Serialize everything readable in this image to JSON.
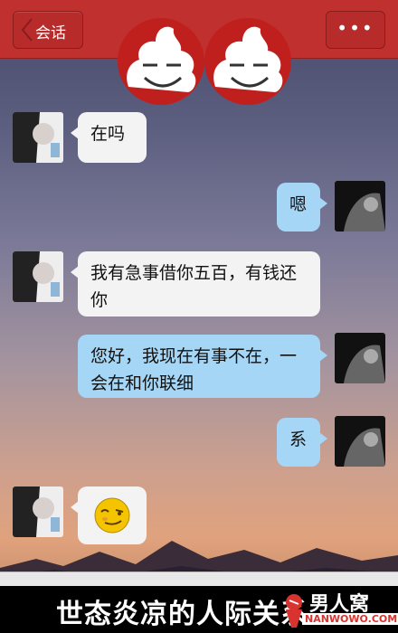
{
  "topbar": {
    "back_label": "会话",
    "title": "",
    "more_label": "•••"
  },
  "messages": [
    {
      "side": "in",
      "text": "在吗"
    },
    {
      "side": "out",
      "text": "嗯"
    },
    {
      "side": "in",
      "text": "我有急事借你五百，有钱还你"
    },
    {
      "side": "out",
      "text": "您好，我现在有事不在，一会在和你联细"
    },
    {
      "side": "out",
      "text": "系"
    },
    {
      "side": "in",
      "text": "",
      "emoji": "smirk-emoji"
    }
  ],
  "caption": {
    "text": "世态炎凉的人际关系"
  },
  "logo": {
    "name": "男人窝",
    "url": "NANWOWO.COM"
  },
  "colors": {
    "header": "#c0302f",
    "incoming_bubble": "#f3f3f3",
    "outgoing_bubble": "#a6d6f5"
  }
}
